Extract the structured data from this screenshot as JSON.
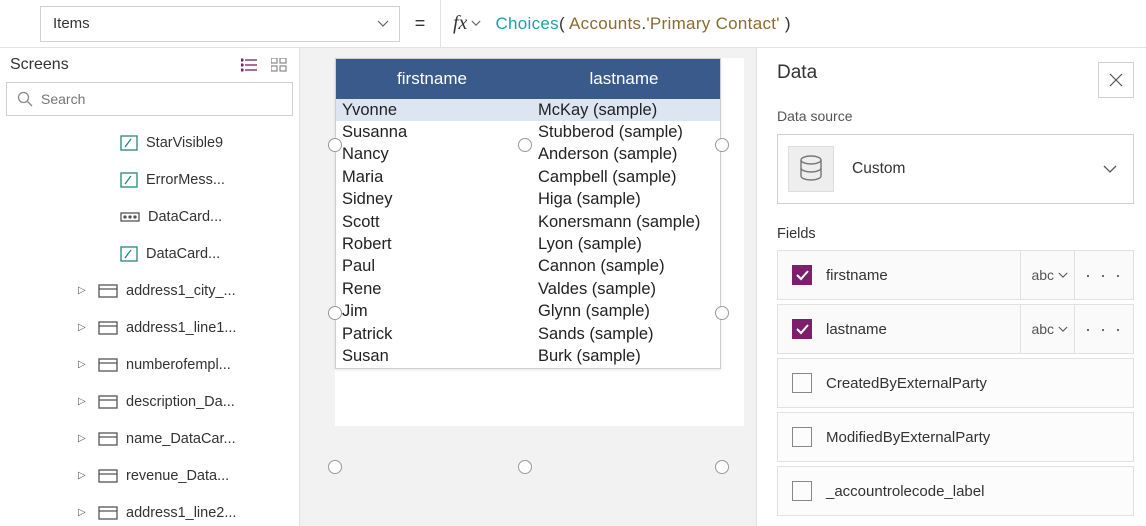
{
  "formulaBar": {
    "property": "Items",
    "formula_fn": "Choices",
    "formula_ref": "Accounts",
    "formula_prop": "'Primary Contact'"
  },
  "screensPanel": {
    "title": "Screens",
    "searchPlaceholder": "Search",
    "items": [
      {
        "label": "StarVisible9",
        "icon": "text",
        "indent": 1,
        "expandable": false
      },
      {
        "label": "ErrorMess...",
        "icon": "text",
        "indent": 1,
        "expandable": false
      },
      {
        "label": "DataCard...",
        "icon": "key",
        "indent": 1,
        "expandable": false
      },
      {
        "label": "DataCard...",
        "icon": "text",
        "indent": 1,
        "expandable": false
      },
      {
        "label": "address1_city_...",
        "icon": "card",
        "indent": 0,
        "expandable": true
      },
      {
        "label": "address1_line1...",
        "icon": "card",
        "indent": 0,
        "expandable": true
      },
      {
        "label": "numberofempl...",
        "icon": "card",
        "indent": 0,
        "expandable": true
      },
      {
        "label": "description_Da...",
        "icon": "card",
        "indent": 0,
        "expandable": true
      },
      {
        "label": "name_DataCar...",
        "icon": "card",
        "indent": 0,
        "expandable": true
      },
      {
        "label": "revenue_Data...",
        "icon": "card",
        "indent": 0,
        "expandable": true
      },
      {
        "label": "address1_line2...",
        "icon": "card",
        "indent": 0,
        "expandable": true
      }
    ]
  },
  "dataTable": {
    "headers": [
      "firstname",
      "lastname"
    ],
    "rows": [
      {
        "first": "Yvonne",
        "last": "McKay (sample)",
        "selected": true
      },
      {
        "first": "Susanna",
        "last": "Stubberod (sample)"
      },
      {
        "first": "Nancy",
        "last": "Anderson (sample)"
      },
      {
        "first": "Maria",
        "last": "Campbell (sample)"
      },
      {
        "first": "Sidney",
        "last": "Higa (sample)"
      },
      {
        "first": "Scott",
        "last": "Konersmann (sample)"
      },
      {
        "first": "Robert",
        "last": "Lyon (sample)"
      },
      {
        "first": "Paul",
        "last": "Cannon (sample)"
      },
      {
        "first": "Rene",
        "last": "Valdes (sample)"
      },
      {
        "first": "Jim",
        "last": "Glynn (sample)"
      },
      {
        "first": "Patrick",
        "last": "Sands (sample)"
      },
      {
        "first": "Susan",
        "last": "Burk (sample)"
      }
    ]
  },
  "dataPanel": {
    "title": "Data",
    "dataSourceLabel": "Data source",
    "dataSourceName": "Custom",
    "fieldsLabel": "Fields",
    "fields": [
      {
        "name": "firstname",
        "checked": true,
        "type": "abc"
      },
      {
        "name": "lastname",
        "checked": true,
        "type": "abc"
      },
      {
        "name": "CreatedByExternalParty",
        "checked": false
      },
      {
        "name": "ModifiedByExternalParty",
        "checked": false
      },
      {
        "name": "_accountrolecode_label",
        "checked": false
      }
    ]
  }
}
